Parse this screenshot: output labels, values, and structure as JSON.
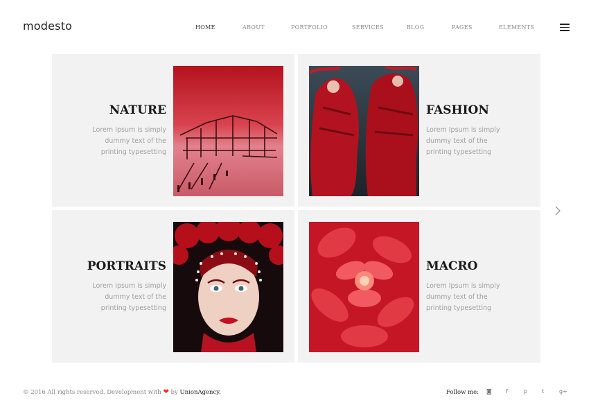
{
  "logo": "modesto",
  "nav": {
    "items": [
      "HOME",
      "ABOUT",
      "PORTFOLIO",
      "SERVICES",
      "BLOG",
      "PAGES",
      "ELEMENTS"
    ],
    "active": "HOME"
  },
  "tiles": [
    {
      "title": "NATURE",
      "text": "Lorem Ipsum is simply dummy text of the printing typesetting"
    },
    {
      "title": "FASHION",
      "text": "Lorem Ipsum is simply dummy text of the printing typesetting"
    },
    {
      "title": "PORTRAITS",
      "text": "Lorem Ipsum is simply dummy text of the printing typesetting"
    },
    {
      "title": "MACRO",
      "text": "Lorem Ipsum is simply dummy text of the printing typesetting"
    }
  ],
  "footer": {
    "copyright_prefix": "© 2016 All rights reserved. Development with",
    "heart": "❤",
    "by": "by",
    "brand": "UnionAgency.",
    "follow_label": "Follow me:",
    "social": [
      {
        "name": "instagram-icon",
        "glyph": "◙"
      },
      {
        "name": "facebook-icon",
        "glyph": "f"
      },
      {
        "name": "pinterest-icon",
        "glyph": "p"
      },
      {
        "name": "twitter-icon",
        "glyph": "t"
      },
      {
        "name": "google-plus-icon",
        "glyph": "g+"
      }
    ]
  },
  "colors": {
    "accent": "#e8312f",
    "tile_bg": "#f2f2f2",
    "text_muted": "#a0a0a0"
  }
}
